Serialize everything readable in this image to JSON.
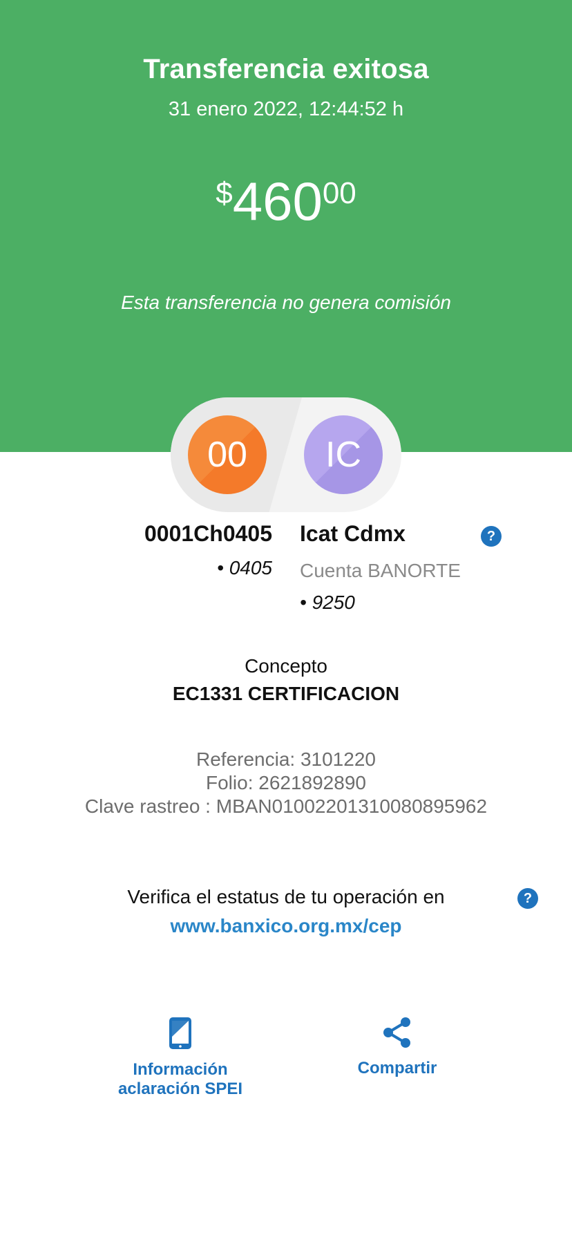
{
  "header": {
    "title": "Transferencia exitosa",
    "datetime": "31 enero 2022, 12:44:52 h",
    "amount": {
      "currency": "$",
      "integer": "460",
      "decimals": "00"
    },
    "commission_note": "Esta transferencia no genera comisión"
  },
  "colors": {
    "header_bg": "#4caf64",
    "accent_blue": "#1f73bd",
    "link_blue": "#2a86c8",
    "sender_avatar": "#f47a2a",
    "receiver_avatar": "#a696e6"
  },
  "sender": {
    "initials": "00",
    "name": "0001Ch0405",
    "account": "• 0405"
  },
  "receiver": {
    "initials": "IC",
    "name": "Icat Cdmx",
    "bank": "Cuenta BANORTE",
    "account": "• 9250"
  },
  "help_glyph": "?",
  "concept": {
    "label": "Concepto",
    "value": "EC1331 CERTIFICACION"
  },
  "references": {
    "referencia": "Referencia: 3101220",
    "folio": "Folio: 2621892890",
    "clave_rastreo": "Clave rastreo : MBAN01002201310080895962"
  },
  "verify": {
    "text": "Verifica el estatus de tu operación en",
    "link": "www.banxico.org.mx/cep"
  },
  "actions": {
    "info": {
      "line1": "Información",
      "line2": "aclaración SPEI",
      "icon": "phone-icon"
    },
    "share": {
      "label": "Compartir",
      "icon": "share-icon"
    }
  }
}
